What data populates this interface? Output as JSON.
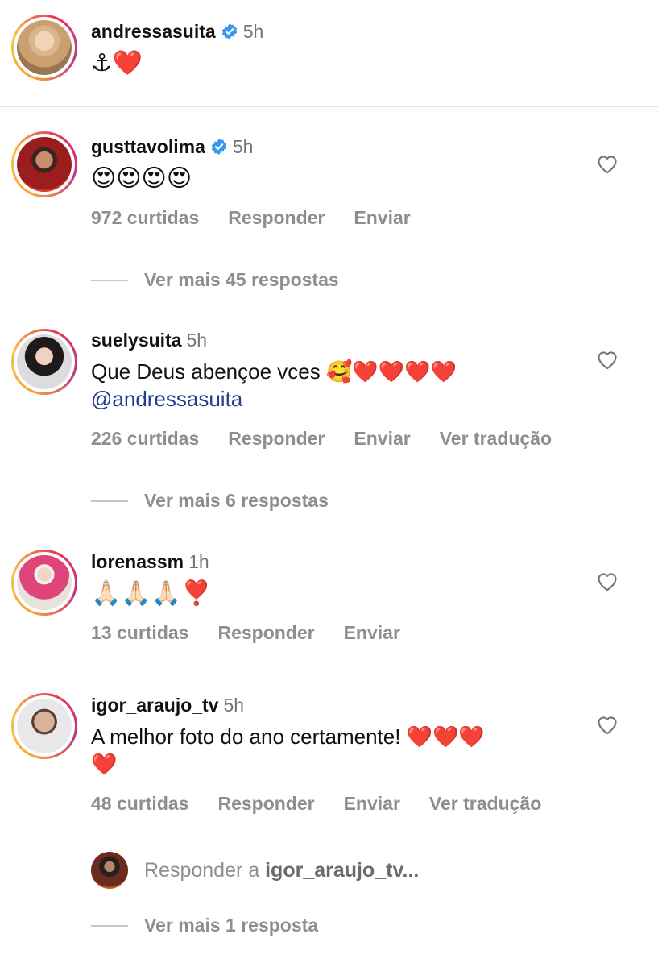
{
  "caption": {
    "username": "andressasuita",
    "time": "5h",
    "text": "⚓❤️",
    "verified": true
  },
  "comments": [
    {
      "username": "gusttavolima",
      "time": "5h",
      "verified": true,
      "text": "😍😍😍😍",
      "likes": "972 curtidas",
      "reply": "Responder",
      "send": "Enviar",
      "view_more": "Ver mais 45 respostas"
    },
    {
      "username": "suelysuita",
      "time": "5h",
      "verified": false,
      "text": "Que Deus abençoe vces 🥰❤️❤️❤️❤️",
      "mention": "@andressasuita",
      "likes": "226 curtidas",
      "reply": "Responder",
      "send": "Enviar",
      "translate": "Ver tradução",
      "view_more": "Ver mais 6 respostas"
    },
    {
      "username": "lorenassm",
      "time": "1h",
      "verified": false,
      "text": "🙏🏻🙏🏻🙏🏻❣️",
      "likes": "13 curtidas",
      "reply": "Responder",
      "send": "Enviar"
    },
    {
      "username": "igor_araujo_tv",
      "time": "5h",
      "verified": false,
      "text": "A melhor foto do ano certamente! ❤️❤️❤️",
      "text_line2": "❤️",
      "likes": "48 curtidas",
      "reply": "Responder",
      "send": "Enviar",
      "translate": "Ver tradução",
      "reply_prompt_prefix": "Responder a",
      "reply_prompt_user": "igor_araujo_tv...",
      "view_more": "Ver mais 1 resposta"
    }
  ],
  "colors": {
    "verified_blue": "#3897f0",
    "secondary_text": "#8e8e8e",
    "mention": "#1e3f8b",
    "heart_red": "#e0263a"
  }
}
